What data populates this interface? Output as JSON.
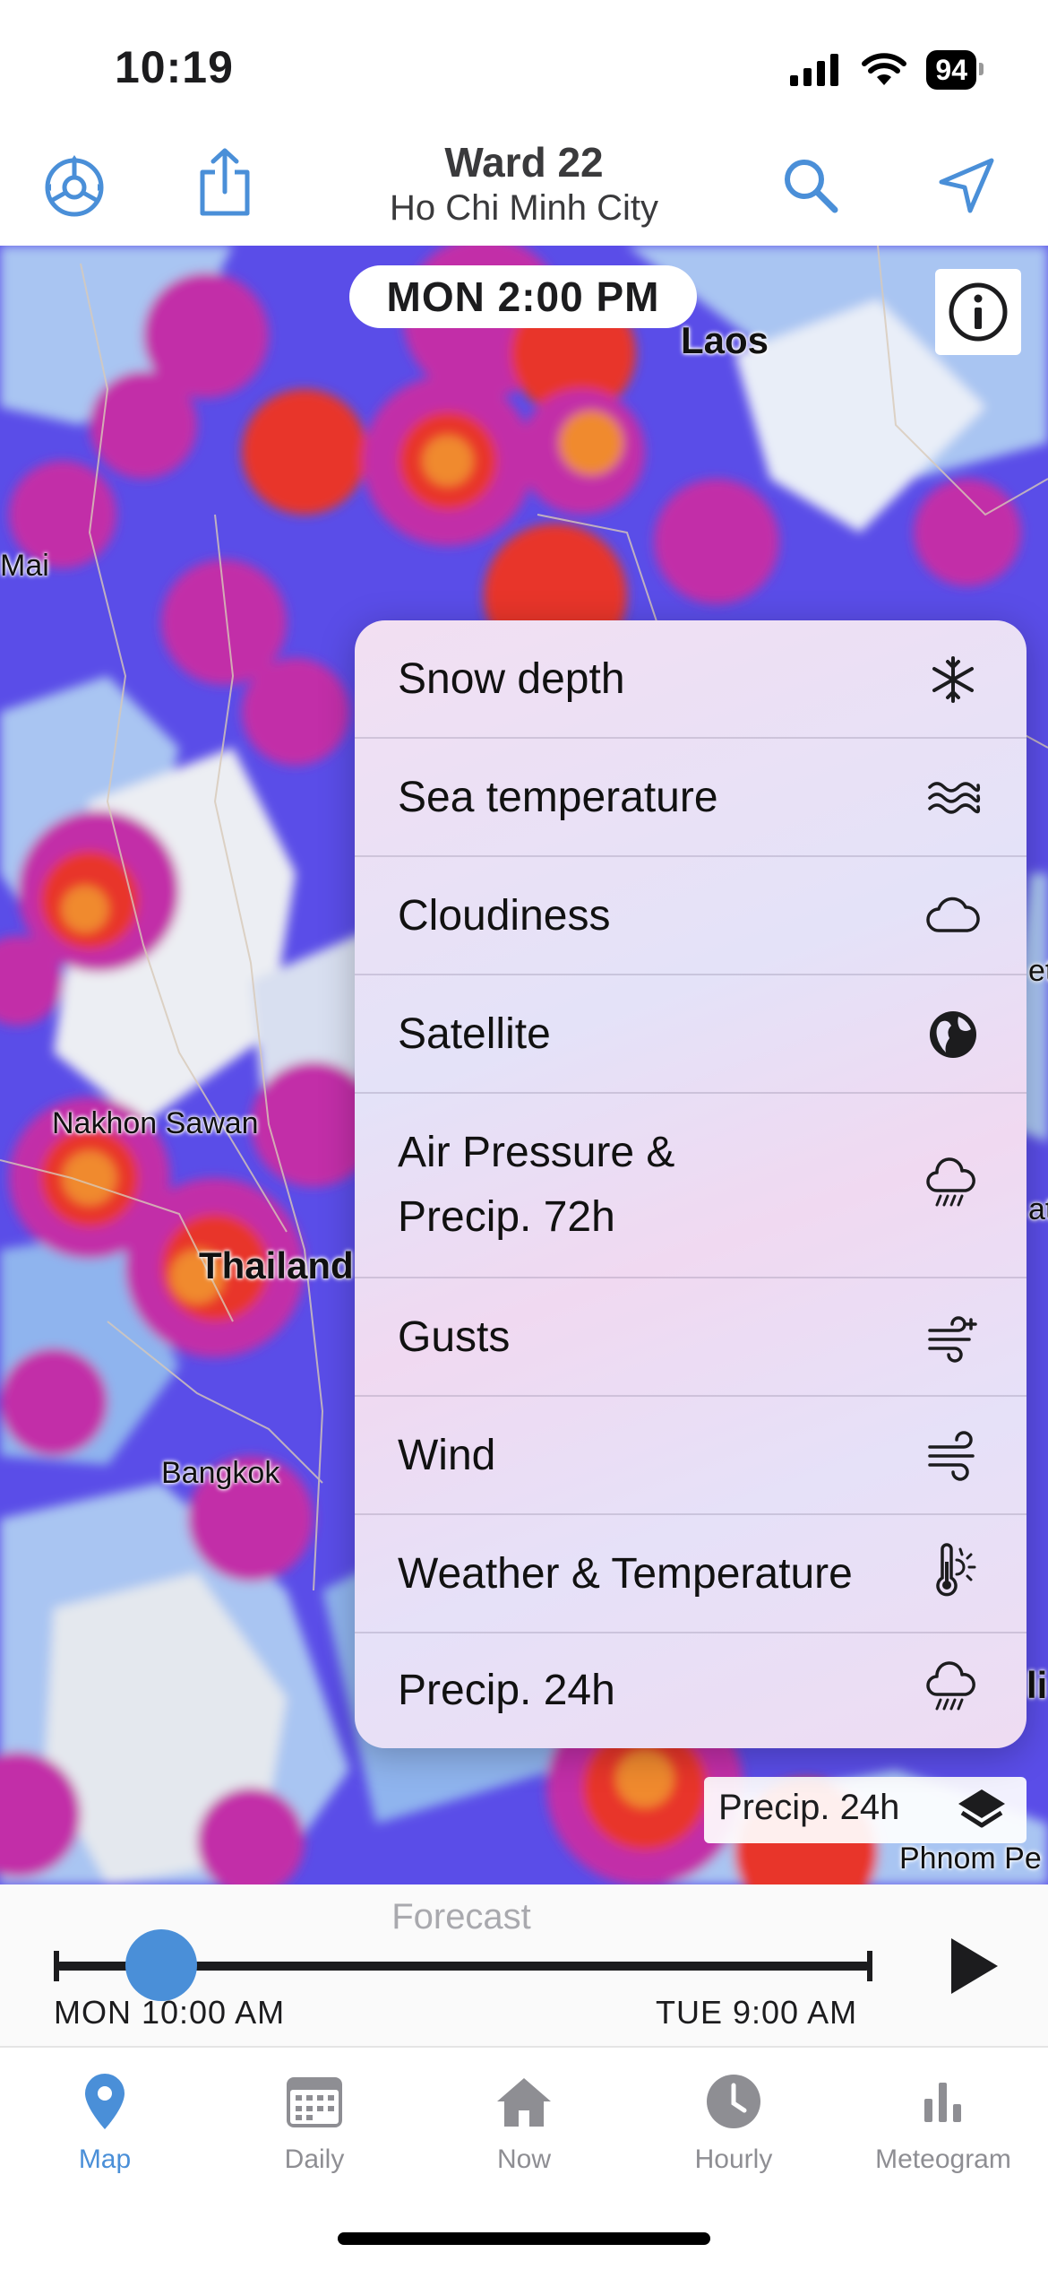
{
  "status_bar": {
    "time": "10:19",
    "battery": "94"
  },
  "header": {
    "title": "Ward 22",
    "subtitle": "Ho Chi Minh City"
  },
  "map": {
    "time_label": "MON  2:00 PM",
    "places": {
      "laos": "Laos",
      "mai": "Mai",
      "nakhon_sawan": "Nakhon Sawan",
      "thailand": "Thailand",
      "bangkok": "Bangkok",
      "phnom_penh": "Phnom Pe",
      "right_et": "et",
      "right_at": "at",
      "right_li": "li"
    }
  },
  "layer_menu": {
    "items": [
      {
        "label": "Snow depth",
        "icon": "snowflake-icon"
      },
      {
        "label": "Sea temperature",
        "icon": "waves-icon"
      },
      {
        "label": "Cloudiness",
        "icon": "cloud-icon"
      },
      {
        "label": "Satellite",
        "icon": "globe-icon"
      },
      {
        "label": "Air Pressure &\nPrecip. 72h",
        "icon": "rain-cloud-icon"
      },
      {
        "label": "Gusts",
        "icon": "gust-wind-icon"
      },
      {
        "label": "Wind",
        "icon": "wind-icon"
      },
      {
        "label": "Weather & Temperature",
        "icon": "thermometer-sun-icon"
      },
      {
        "label": "Precip. 24h",
        "icon": "rain-cloud-icon"
      }
    ]
  },
  "layer_button": {
    "label": "Precip. 24h"
  },
  "timeline": {
    "label": "Forecast",
    "start": "MON 10:00 AM",
    "end": "TUE 9:00 AM",
    "position": 0.13
  },
  "tabs": [
    {
      "label": "Map",
      "icon": "map-pin-icon",
      "active": true
    },
    {
      "label": "Daily",
      "icon": "calendar-icon",
      "active": false
    },
    {
      "label": "Now",
      "icon": "home-icon",
      "active": false
    },
    {
      "label": "Hourly",
      "icon": "clock-icon",
      "active": false
    },
    {
      "label": "Meteogram",
      "icon": "bar-chart-icon",
      "active": false
    }
  ],
  "colors": {
    "accent": "#4a8fd8",
    "precip_heavy": "#e8342a",
    "precip_mid": "#c22fa8",
    "precip_low": "#5a4de8",
    "precip_light": "#8fb4ee"
  }
}
